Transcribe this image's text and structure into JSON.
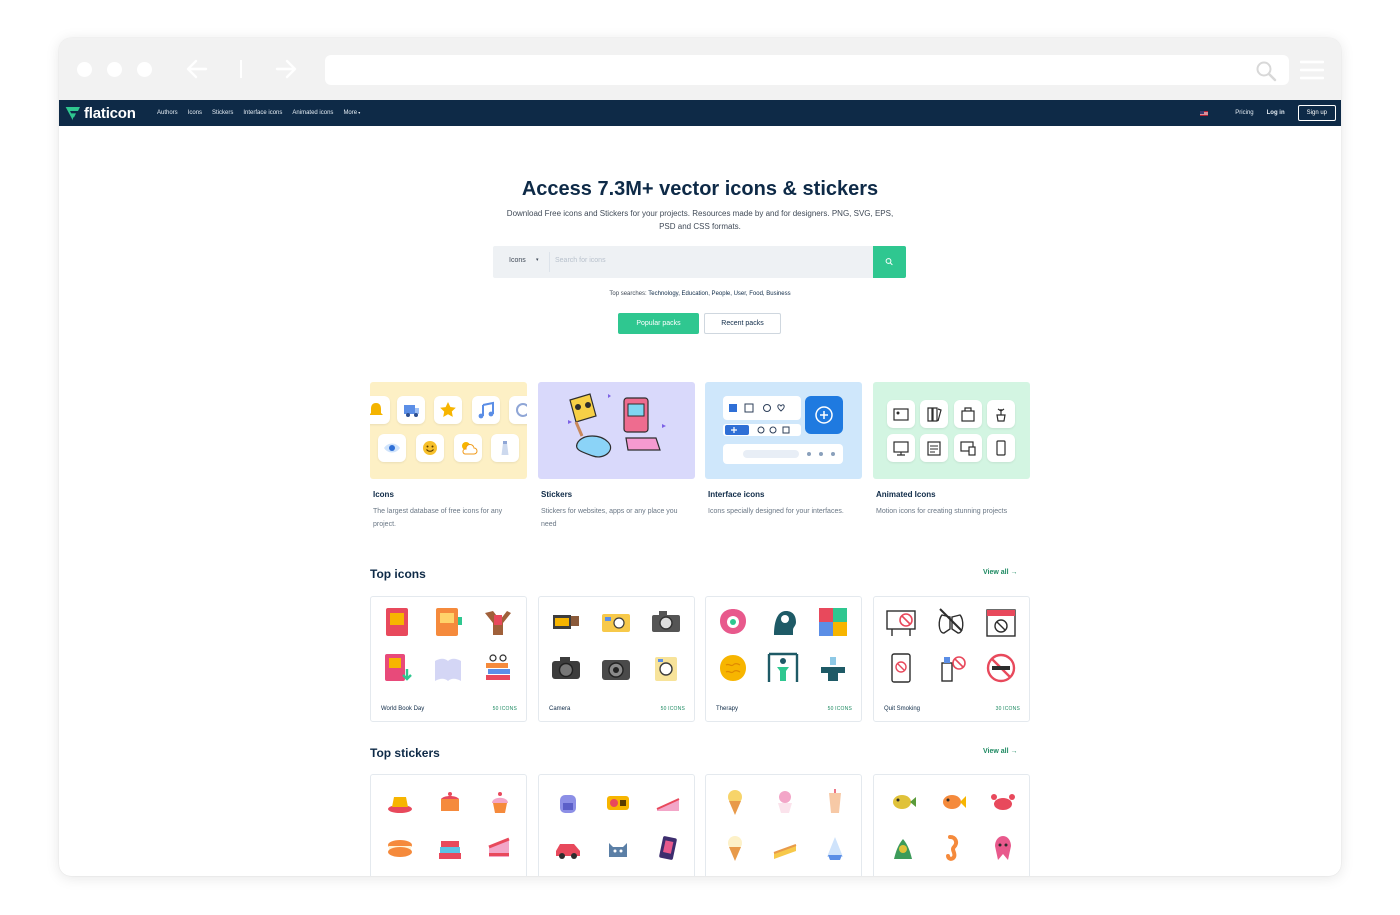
{
  "nav": {
    "logo": "flaticon",
    "links": [
      "Authors",
      "Icons",
      "Stickers",
      "Interface icons",
      "Animated icons",
      "More"
    ],
    "pricing": "Pricing",
    "login": "Log in",
    "signup": "Sign up"
  },
  "hero": {
    "title": "Access 7.3M+ vector icons & stickers",
    "subtitle": "Download Free icons and Stickers for your projects. Resources made by and for designers. PNG, SVG, EPS, PSD and CSS formats.",
    "search_type": "Icons",
    "search_placeholder": "Search for icons",
    "top_searches_label": "Top searches:",
    "top_searches": "Technology, Education, People, User, Food, Business",
    "btn_popular": "Popular packs",
    "btn_recent": "Recent packs"
  },
  "categories": [
    {
      "title": "Icons",
      "desc": "The largest database of free icons for any project."
    },
    {
      "title": "Stickers",
      "desc": "Stickers for websites, apps or any place you need"
    },
    {
      "title": "Interface icons",
      "desc": "Icons specially designed for your interfaces."
    },
    {
      "title": "Animated Icons",
      "desc": "Motion icons for creating stunning projects"
    }
  ],
  "top_icons": {
    "title": "Top icons",
    "view_all": "View all",
    "packs": [
      {
        "name": "World Book Day",
        "count": "50 ICONS"
      },
      {
        "name": "Camera",
        "count": "50 ICONS"
      },
      {
        "name": "Therapy",
        "count": "50 ICONS"
      },
      {
        "name": "Quit Smoking",
        "count": "30 ICONS"
      }
    ]
  },
  "top_stickers": {
    "title": "Top stickers",
    "view_all": "View all"
  },
  "colors": {
    "navy": "#0e2a47",
    "green": "#2fc790",
    "link_green": "#1e8a62"
  }
}
